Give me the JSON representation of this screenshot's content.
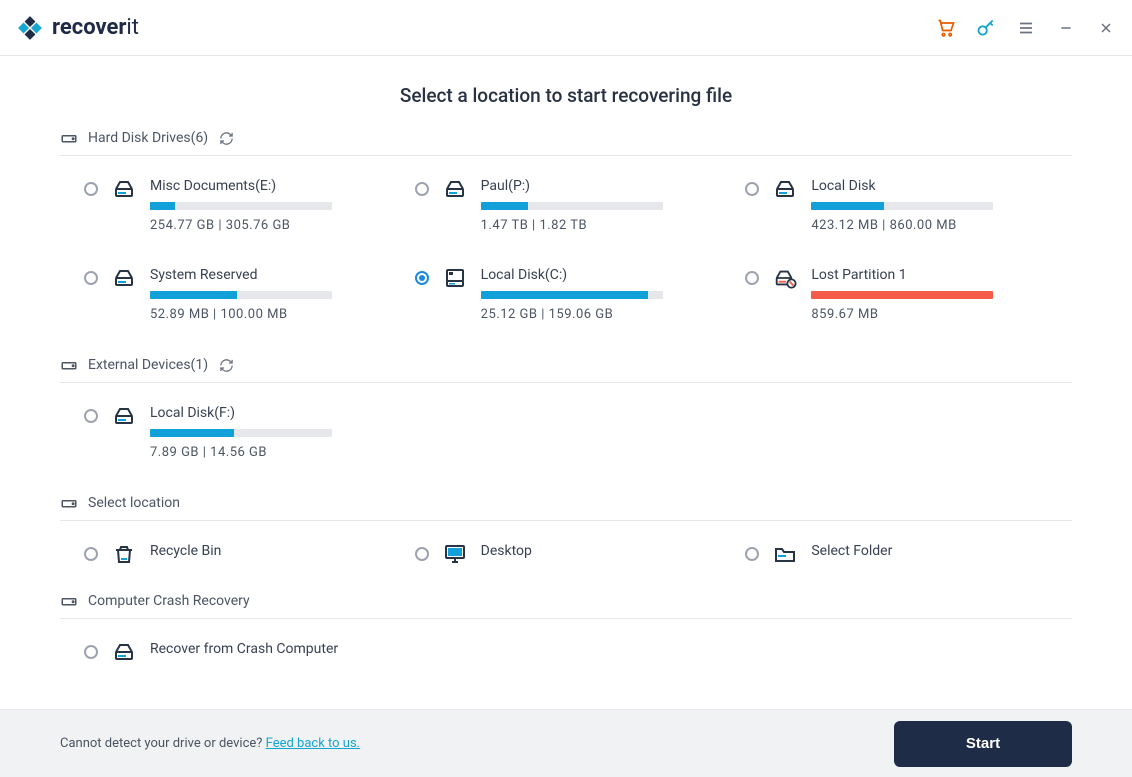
{
  "brand": {
    "name_a": "recover",
    "name_b": "it"
  },
  "page_title": "Select a location to start recovering file",
  "sections": {
    "hdd": {
      "label": "Hard Disk Drives(6)"
    },
    "ext": {
      "label": "External Devices(1)"
    },
    "loc": {
      "label": "Select location"
    },
    "crash": {
      "label": "Computer Crash Recovery"
    }
  },
  "drives": {
    "e": {
      "name": "Misc Documents(E:)",
      "meta": "254.77  GB | 305.76  GB",
      "pct": 14
    },
    "p": {
      "name": "Paul(P:)",
      "meta": "1.47  TB | 1.82  TB",
      "pct": 26
    },
    "local": {
      "name": "Local Disk",
      "meta": "423.12  MB | 860.00  MB",
      "pct": 40
    },
    "sys": {
      "name": "System Reserved",
      "meta": "52.89  MB | 100.00  MB",
      "pct": 48
    },
    "c": {
      "name": "Local Disk(C:)",
      "meta": "25.12  GB | 159.06  GB",
      "pct": 92
    },
    "lost": {
      "name": "Lost Partition 1",
      "meta": "859.67  MB",
      "pct": 100
    },
    "f": {
      "name": "Local Disk(F:)",
      "meta": "7.89  GB | 14.56  GB",
      "pct": 46
    }
  },
  "locations": {
    "recycle": "Recycle Bin",
    "desktop": "Desktop",
    "folder": "Select Folder"
  },
  "crash": {
    "recover": "Recover from Crash Computer"
  },
  "footer": {
    "text": "Cannot detect your drive or device? ",
    "link": "Feed back to us."
  },
  "start_label": "Start"
}
